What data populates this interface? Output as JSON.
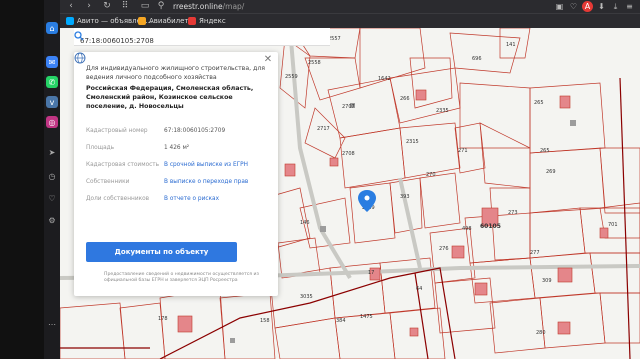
{
  "browser": {
    "nav": {
      "back": "‹",
      "forward": "›",
      "reload": "↻",
      "menu": "⠿"
    },
    "url_domain": "rreestr.online",
    "url_path": "/map/",
    "bookmarks": [
      {
        "label": "Авито — объявлен...",
        "color": "#00aaff"
      },
      {
        "label": "Авиабилеты",
        "color": "#f5a623"
      },
      {
        "label": "Яндекс",
        "color": "#e53935"
      }
    ]
  },
  "sidebar": {
    "icons": [
      "home-icon",
      "messenger-icon",
      "whatsapp-icon",
      "vk-icon",
      "instagram-icon",
      "send-icon",
      "clock-icon",
      "heart-icon",
      "settings-icon",
      "more-icon"
    ]
  },
  "search": {
    "value": "67:18:0060105:2708"
  },
  "card": {
    "description": "Для индивидуального жилищного строительства, для ведения личного подсобного хозяйства",
    "address": "Российская Федерация, Смоленская область, Смоленский район, Козинское сельское поселение, д. Новосельцы",
    "rows": [
      {
        "key": "Кадастровый номер",
        "value": "67:18:0060105:2709",
        "link": false
      },
      {
        "key": "Площадь",
        "value": "1 426 м²",
        "link": false
      },
      {
        "key": "Кадастровая стоимость",
        "value": "В срочной выписке из ЕГРН",
        "link": true
      },
      {
        "key": "Собственники",
        "value": "В выписке о переходе прав",
        "link": true
      },
      {
        "key": "Доли собственников",
        "value": "В отчете о рисках",
        "link": true
      }
    ],
    "button": "Документы по объекту",
    "note": "Предоставление сведений о недвижимости осуществляется из официальной базы ЕГРН и заверяется ЭЦП Росреестра"
  },
  "map_labels": [
    "2557",
    "2558",
    "2559",
    "1642",
    "141",
    "696",
    "265",
    "2707",
    "2335",
    "266",
    "2717",
    "2708",
    "2315",
    "271",
    "270",
    "2709",
    "393",
    "265",
    "269",
    "146",
    "276",
    "498",
    "60105",
    "273",
    "277",
    "701",
    "3035",
    "17",
    "384",
    "1475",
    "178",
    "158",
    "309",
    "280",
    "64"
  ],
  "colors": {
    "accent": "#2f78e0",
    "parcel_line": "#c0392b",
    "boundary": "#8b0000",
    "marker": "#2a7de1"
  }
}
